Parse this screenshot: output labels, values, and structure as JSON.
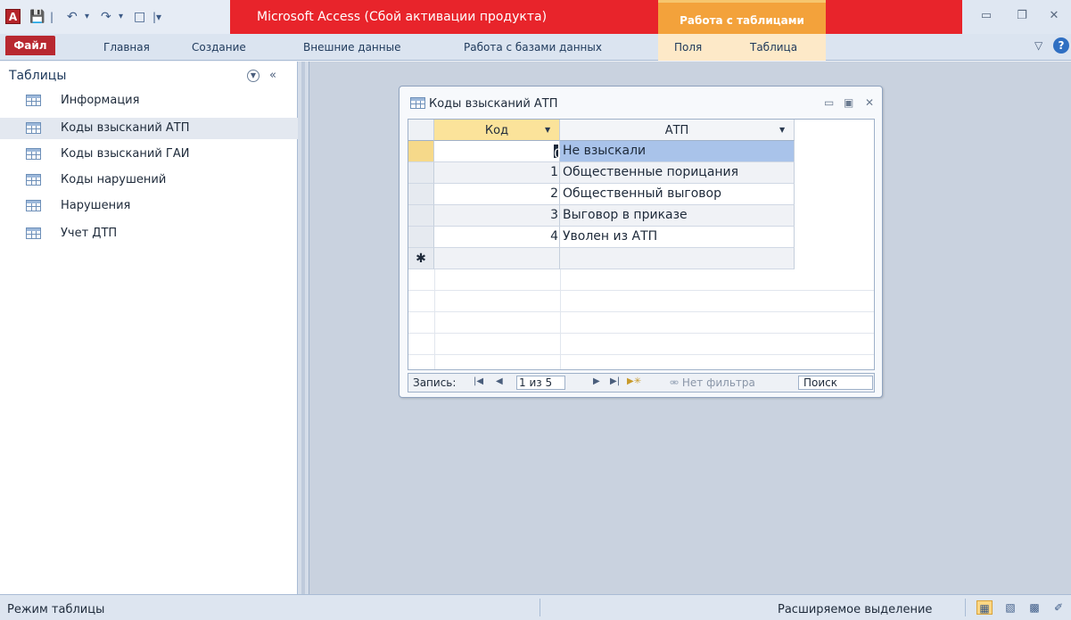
{
  "titlebar": {
    "app_icon_letter": "A",
    "title": "Microsoft Access (Сбой активации продукта)",
    "context_tab": "Работа с таблицами",
    "colors": {
      "red": "#e8242b",
      "context": "#f3a23b"
    }
  },
  "ribbon": {
    "tabs": [
      "Файл",
      "Главная",
      "Создание",
      "Внешние данные",
      "Работа с базами данных",
      "Поля",
      "Таблица"
    ]
  },
  "nav_pane": {
    "title": "Таблицы",
    "items": [
      {
        "label": "Информация",
        "selected": false
      },
      {
        "label": "Коды взысканий АТП",
        "selected": true
      },
      {
        "label": "Коды взысканий ГАИ",
        "selected": false
      },
      {
        "label": "Коды нарушений",
        "selected": false
      },
      {
        "label": "Нарушения",
        "selected": false
      },
      {
        "label": "Учет ДТП",
        "selected": false
      }
    ]
  },
  "table_window": {
    "title": "Коды взысканий АТП",
    "columns": [
      "Код",
      "АТП"
    ],
    "rows": [
      {
        "code": "0",
        "value": "Не взыскали"
      },
      {
        "code": "1",
        "value": "Общественные порицания"
      },
      {
        "code": "2",
        "value": "Общественный выговор"
      },
      {
        "code": "3",
        "value": "Выговор в приказе"
      },
      {
        "code": "4",
        "value": "Уволен из АТП"
      }
    ],
    "new_row_marker": "✱",
    "record_nav": {
      "label": "Запись:",
      "position": "1 из 5",
      "filter": "Нет фильтра",
      "search": "Поиск"
    }
  },
  "statusbar": {
    "left": "Режим таблицы",
    "right": "Расширяемое выделение"
  }
}
